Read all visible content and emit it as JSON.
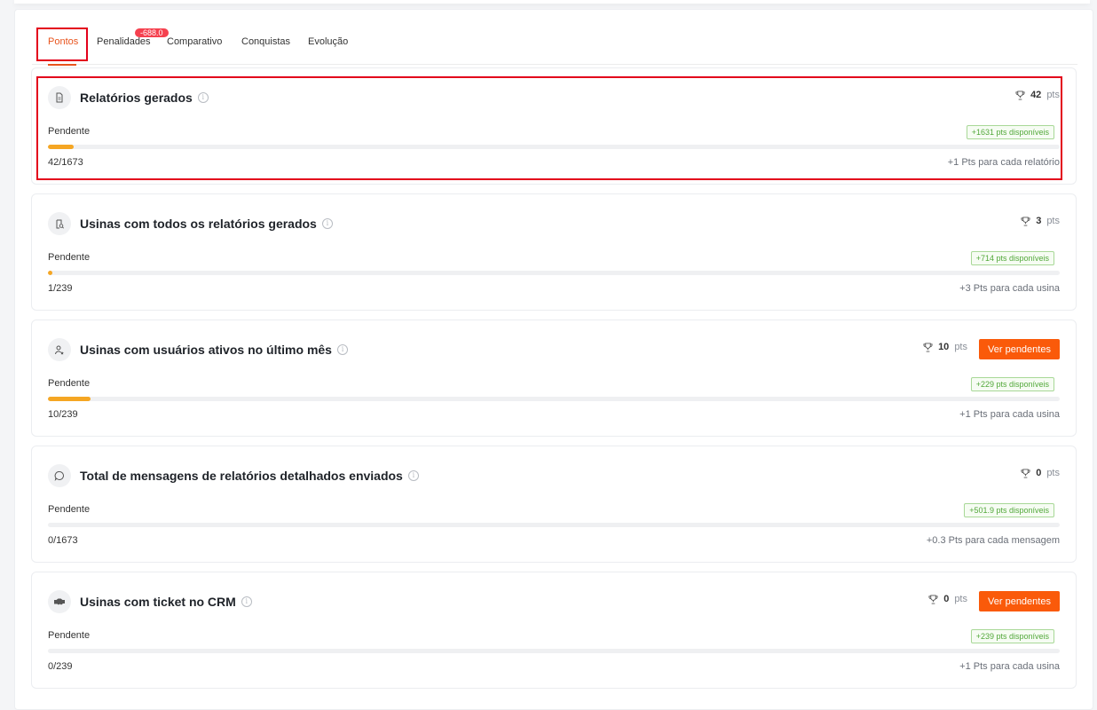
{
  "tabs": [
    {
      "label": "Pontos"
    },
    {
      "label": "Penalidades",
      "badge": "-688.0"
    },
    {
      "label": "Comparativo"
    },
    {
      "label": "Conquistas"
    },
    {
      "label": "Evolução"
    }
  ],
  "pts_unit": "pts",
  "ver_pendentes_label": "Ver pendentes",
  "cards": [
    {
      "title": "Relatórios gerados",
      "icon": "document-icon",
      "points": "42",
      "status": "Pendente",
      "available": "+1631 pts disponíveis",
      "progress": 42,
      "total": 1673,
      "count": "42/1673",
      "rule": "+1 Pts para cada relatório"
    },
    {
      "title": "Usinas com todos os relatórios gerados",
      "icon": "report-check-icon",
      "points": "3",
      "status": "Pendente",
      "available": "+714 pts disponíveis",
      "progress": 1,
      "total": 239,
      "count": "1/239",
      "rule": "+3 Pts para cada usina"
    },
    {
      "title": "Usinas com usuários ativos no último mês",
      "icon": "user-icon",
      "points": "10",
      "status": "Pendente",
      "available": "+229 pts disponíveis",
      "progress": 10,
      "total": 239,
      "count": "10/239",
      "rule": "+1 Pts para cada usina"
    },
    {
      "title": "Total de mensagens de relatórios detalhados enviados",
      "icon": "message-icon",
      "points": "0",
      "status": "Pendente",
      "available": "+501.9 pts disponíveis",
      "progress": 0,
      "total": 1673,
      "count": "0/1673",
      "rule": "+0.3 Pts para cada mensagem"
    },
    {
      "title": "Usinas com ticket no CRM",
      "icon": "handshake-icon",
      "points": "0",
      "status": "Pendente",
      "available": "+239 pts disponíveis",
      "progress": 0,
      "total": 239,
      "count": "0/239",
      "rule": "+1 Pts para cada usina"
    }
  ],
  "colors": {
    "accent": "#e8541e",
    "button": "#fa5a0a",
    "progress": "#f5a623",
    "available": "#52a83a"
  }
}
